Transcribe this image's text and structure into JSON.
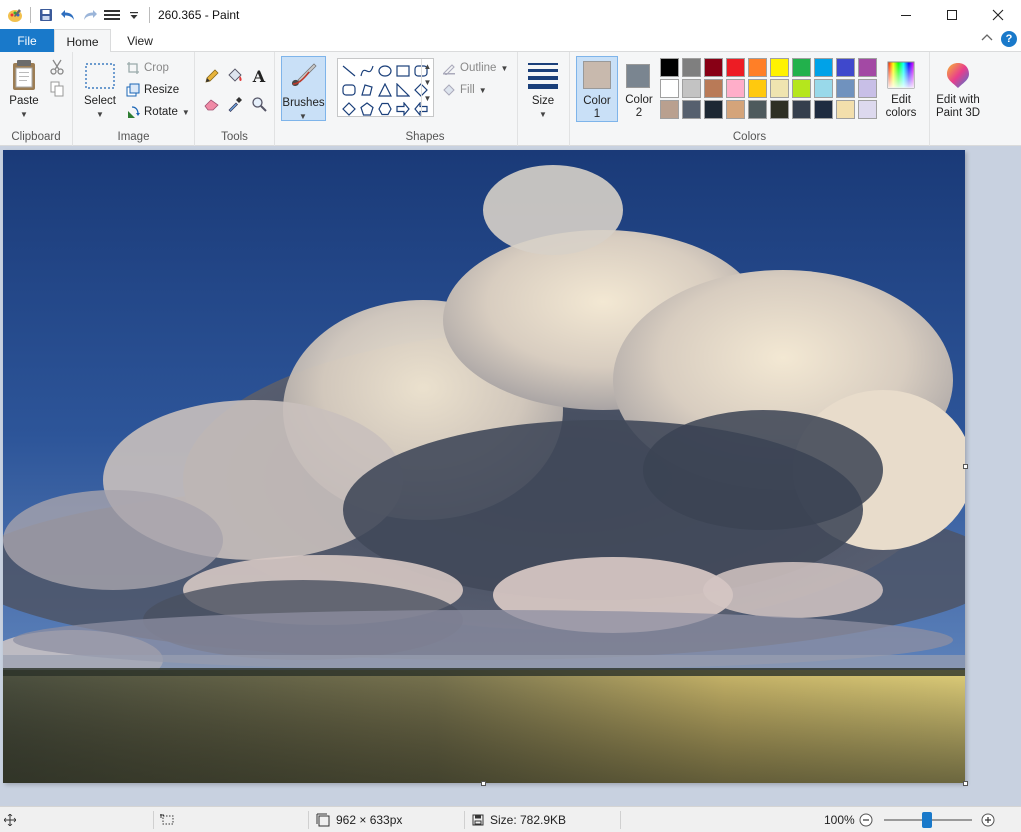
{
  "window": {
    "title": "260.365 - Paint"
  },
  "tabs": {
    "file": "File",
    "home": "Home",
    "view": "View"
  },
  "ribbon": {
    "clipboard": {
      "paste": "Paste",
      "group": "Clipboard"
    },
    "image": {
      "select": "Select",
      "crop": "Crop",
      "resize": "Resize",
      "rotate": "Rotate",
      "group": "Image"
    },
    "tools": {
      "group": "Tools",
      "text_glyph": "A"
    },
    "brushes": {
      "label": "Brushes"
    },
    "shapes": {
      "outline": "Outline",
      "fill": "Fill",
      "group": "Shapes"
    },
    "size": {
      "label": "Size"
    },
    "colors": {
      "color1_label": "Color",
      "color1_num": "1",
      "color2_label": "Color",
      "color2_num": "2",
      "color1_value": "#c8b9ad",
      "color2_value": "#7a8590",
      "edit_line1": "Edit",
      "edit_line2": "colors",
      "paint3d_line1": "Edit with",
      "paint3d_line2": "Paint 3D",
      "group": "Colors",
      "palette": [
        "#000000",
        "#7f7f7f",
        "#880015",
        "#ed1c24",
        "#ff7f27",
        "#fff200",
        "#22b14c",
        "#00a2e8",
        "#3f48cc",
        "#a349a4",
        "#ffffff",
        "#c3c3c3",
        "#b97a57",
        "#ffaec9",
        "#ffc90e",
        "#efe4b0",
        "#b5e61d",
        "#99d9ea",
        "#7092be",
        "#c8bfe7",
        "#b9a08f",
        "#56606e",
        "#1d2833",
        "#d4a47a",
        "#4e5a5d",
        "#2e2f24",
        "#353f4d",
        "#1f2c40",
        "#f3dfac",
        "#ddd9ee"
      ]
    }
  },
  "status": {
    "dimensions": "962 × 633px",
    "size": "Size: 782.9KB",
    "zoom": "100%"
  }
}
